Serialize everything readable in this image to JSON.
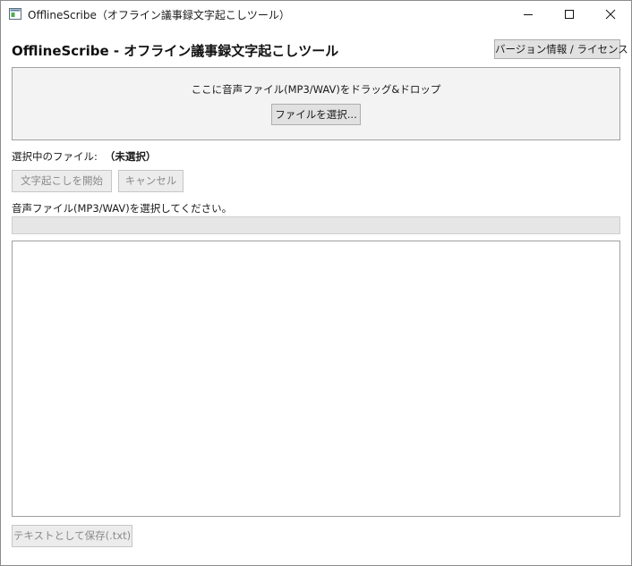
{
  "window": {
    "title": "OfflineScribe（オフライン議事録文字起こしツール）"
  },
  "header": {
    "app_title": "OfflineScribe - オフライン議事録文字起こしツール",
    "about_button": "バージョン情報 / ライセンス"
  },
  "dropzone": {
    "instruction": "ここに音声ファイル(MP3/WAV)をドラッグ&ドロップ",
    "select_button": "ファイルを選択..."
  },
  "file": {
    "label": "選択中のファイル:",
    "value": "（未選択）"
  },
  "actions": {
    "start_button": "文字起こしを開始",
    "cancel_button": "キャンセル"
  },
  "status": {
    "message": "音声ファイル(MP3/WAV)を選択してください。",
    "progress_fraction": 0
  },
  "output": {
    "text": ""
  },
  "footer": {
    "save_button": "テキストとして保存(.txt)"
  }
}
